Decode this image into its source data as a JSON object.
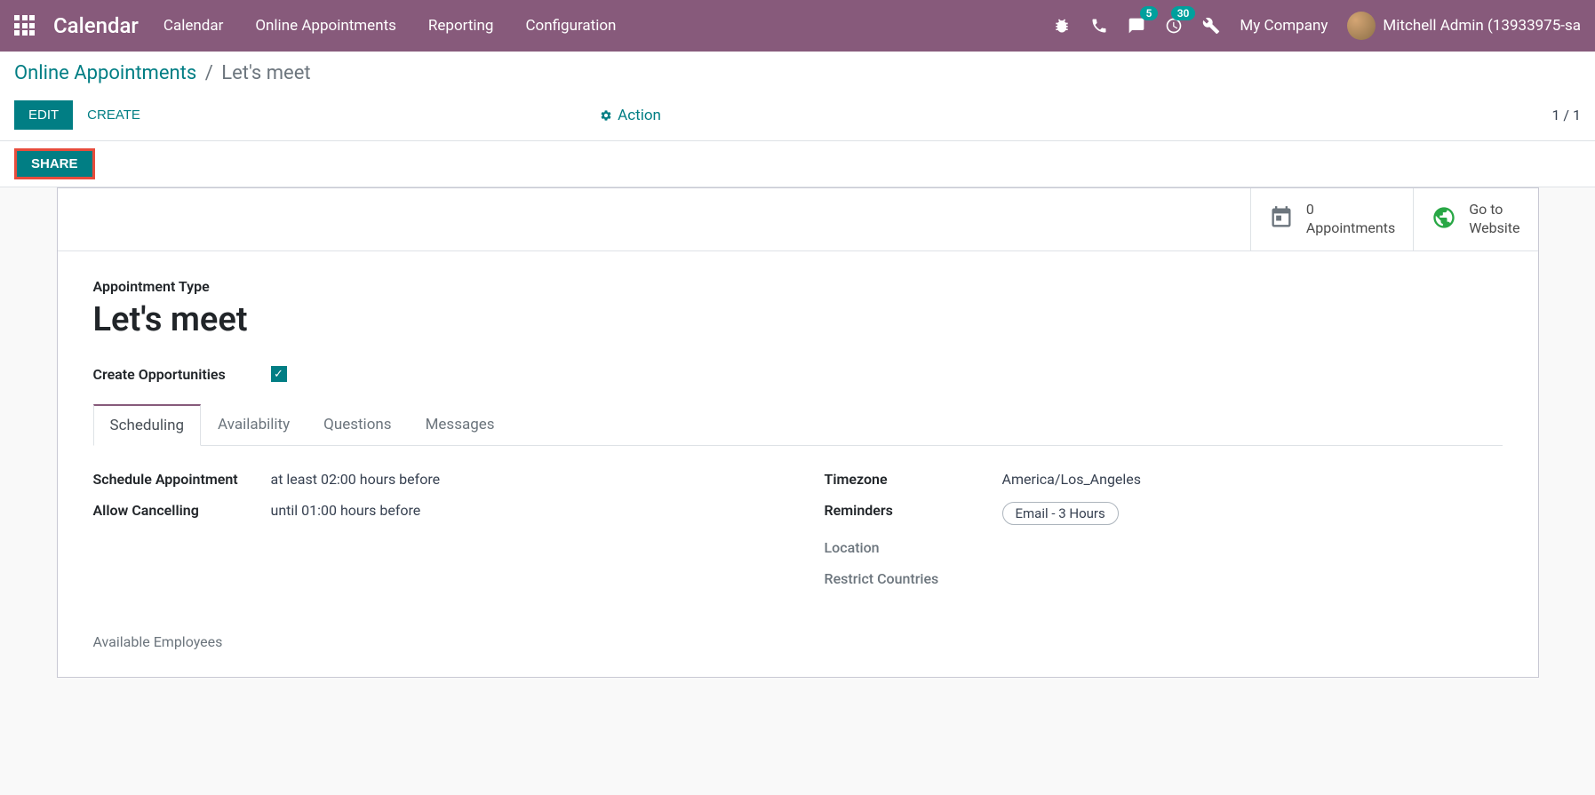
{
  "navbar": {
    "brand": "Calendar",
    "menu": [
      "Calendar",
      "Online Appointments",
      "Reporting",
      "Configuration"
    ],
    "messages_count": "5",
    "activities_count": "30",
    "company": "My Company",
    "user": "Mitchell Admin (13933975-sa"
  },
  "breadcrumb": {
    "parent": "Online Appointments",
    "current": "Let's meet"
  },
  "buttons": {
    "edit": "Edit",
    "create": "Create",
    "action": "Action",
    "share": "Share"
  },
  "pager": "1 / 1",
  "stat_buttons": {
    "appointments_count": "0",
    "appointments_label": "Appointments",
    "website_line1": "Go to",
    "website_line2": "Website"
  },
  "form": {
    "type_label": "Appointment Type",
    "title": "Let's meet",
    "create_opp_label": "Create Opportunities",
    "tabs": [
      "Scheduling",
      "Availability",
      "Questions",
      "Messages"
    ],
    "schedule_label": "Schedule Appointment",
    "schedule_value": "at least 02:00 hours before",
    "cancel_label": "Allow Cancelling",
    "cancel_value": "until 01:00 hours before",
    "tz_label": "Timezone",
    "tz_value": "America/Los_Angeles",
    "reminders_label": "Reminders",
    "reminders_tag": "Email - 3 Hours",
    "location_label": "Location",
    "countries_label": "Restrict Countries",
    "employees_label": "Available Employees"
  }
}
